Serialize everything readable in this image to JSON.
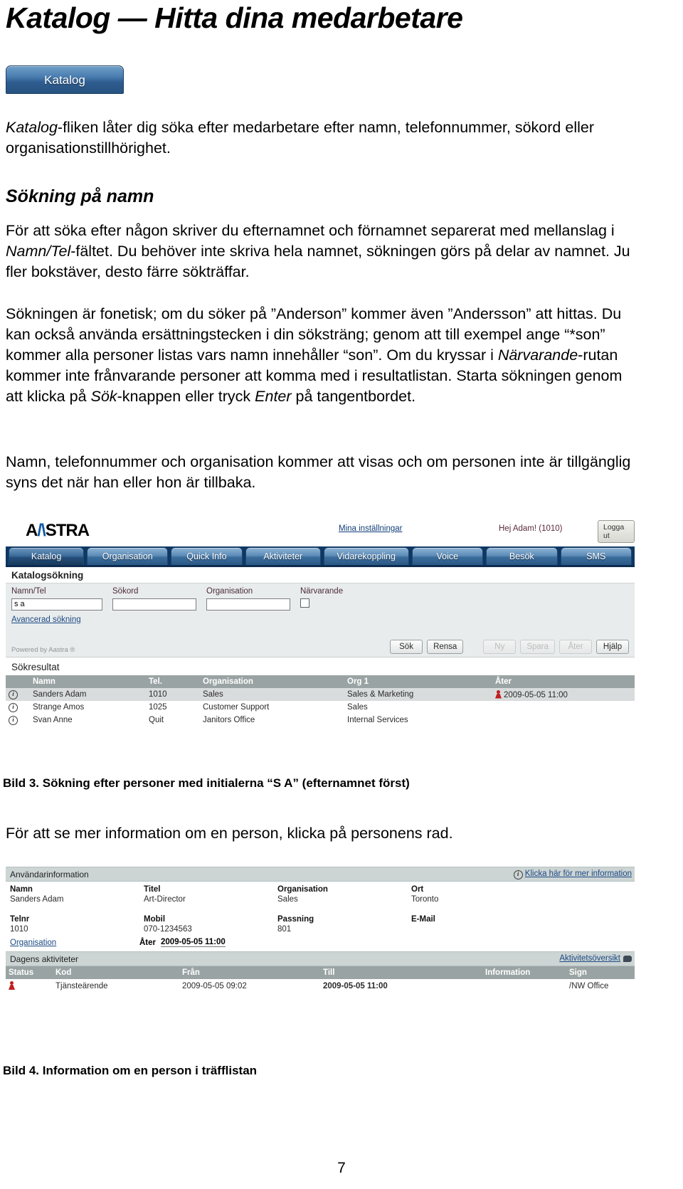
{
  "document": {
    "title": "Katalog — Hitta dina medarbetare",
    "tab_button_label": "Katalog",
    "page_number": "7",
    "paragraph_1": "Katalog-fliken låter dig söka efter medarbetare efter namn, telefonnummer, sökord eller organisationstillhörighet.",
    "section_heading": "Sökning på namn",
    "paragraph_2": "För att söka efter någon skriver du efternamnet och förnamnet separerat med mellanslag i Namn/Tel-fältet. Du behöver inte skriva hela namnet, sökningen görs på delar av namnet. Ju fler bokstäver, desto färre sökträffar.",
    "paragraph_3": "Sökningen är fonetisk; om du söker på ”Anderson” kommer även ”Andersson” att hittas. Du kan också använda ersättningstecken i din söksträng; genom att till exempel ange “*son” kommer alla personer listas vars namn innehåller “son”. Om du kryssar i Närvarande-rutan kommer inte frånvarande personer att komma med i resultatlistan. Starta sökningen genom att klicka på Sök-knappen eller tryck Enter på tangentbordet.",
    "paragraph_4": "Namn, telefonnummer och organisation kommer att visas och om personen inte är tillgänglig syns det när han eller hon är tillbaka.",
    "caption_3": "Bild 3. Sökning efter personer med initialerna “S A” (efternamnet först)",
    "paragraph_5": "För att se mer information om en person, klicka på personens rad.",
    "caption_4": "Bild 4. Information om en person i träfflistan"
  },
  "colors": {
    "tab_active": "#17395c",
    "tab_normal": "#3a6d9c",
    "header_bar": "#0e3763",
    "grid_header": "#9aa3a3",
    "panel_bar": "#ccd4d4",
    "link": "#1c4a84",
    "status_red": "#c01f1f"
  },
  "app": {
    "logo_text": "AASTRA",
    "header": {
      "settings_link": "Mina inställningar",
      "user_greeting": "Hej Adam! (1010)",
      "logout_button": "Logga ut"
    },
    "tabs": [
      {
        "label": "Katalog",
        "active": true
      },
      {
        "label": "Organisation",
        "active": false
      },
      {
        "label": "Quick Info",
        "active": false
      },
      {
        "label": "Aktiviteter",
        "active": false
      },
      {
        "label": "Vidarekoppling",
        "active": false
      },
      {
        "label": "Voice",
        "active": false
      },
      {
        "label": "Besök",
        "active": false
      },
      {
        "label": "SMS",
        "active": false
      }
    ],
    "search": {
      "panel_title": "Katalogsökning",
      "fields": {
        "namn_label": "Namn/Tel",
        "namn_value": "s a",
        "sokord_label": "Sökord",
        "sokord_value": "",
        "organisation_label": "Organisation",
        "organisation_value": "",
        "narvarande_label": "Närvarande",
        "narvarande_checked": false
      },
      "advanced_link": "Avancerad sökning",
      "powered_by": "Powered by Aastra ®",
      "buttons": [
        {
          "label": "Sök",
          "disabled": false
        },
        {
          "label": "Rensa",
          "disabled": false
        },
        {
          "label": "Ny",
          "disabled": true
        },
        {
          "label": "Spara",
          "disabled": true
        },
        {
          "label": "Åter",
          "disabled": true
        },
        {
          "label": "Hjälp",
          "disabled": false
        }
      ]
    },
    "results": {
      "title": "Sökresultat",
      "columns": [
        "",
        "Namn",
        "Tel.",
        "Organisation",
        "Org 1",
        "Åter"
      ],
      "rows": [
        {
          "icon": "info-icon",
          "namn": "Sanders Adam",
          "tel": "1010",
          "organisation": "Sales",
          "org1": "Sales & Marketing",
          "ater": "2009-05-05 11:00",
          "has_status_icon": true,
          "selected": true
        },
        {
          "icon": "info-icon",
          "namn": "Strange Amos",
          "tel": "1025",
          "organisation": "Customer Support",
          "org1": "Sales",
          "ater": "",
          "has_status_icon": false,
          "selected": false
        },
        {
          "icon": "info-icon",
          "namn": "Svan Anne",
          "tel": "Quit",
          "organisation": "Janitors Office",
          "org1": "Internal Services",
          "ater": "",
          "has_status_icon": false,
          "selected": false
        }
      ]
    },
    "user_info": {
      "bar_title": "Användarinformation",
      "more_info_link": "Klicka här för mer information",
      "row1_labels": [
        "Namn",
        "Titel",
        "Organisation",
        "Ort"
      ],
      "row1_values": [
        "Sanders Adam",
        "Art-Director",
        "Sales",
        "Toronto"
      ],
      "row2_labels": [
        "Telnr",
        "Mobil",
        "Passning",
        "E-Mail"
      ],
      "row2_values": [
        "1010",
        "070-1234563",
        "801",
        ""
      ],
      "organisation_link": "Organisation",
      "ater_label": "Åter",
      "ater_value": "2009-05-05 11:00"
    },
    "activities": {
      "bar_title": "Dagens aktiviteter",
      "overview_link": "Aktivitetsöversikt",
      "columns": [
        "Status",
        "Kod",
        "Från",
        "Till",
        "Information",
        "Sign"
      ],
      "rows": [
        {
          "status_icon": "pawn-icon",
          "kod": "Tjänsteärende",
          "fran": "2009-05-05 09:02",
          "till": "2009-05-05 11:00",
          "information": "",
          "sign": "/NW Office"
        }
      ]
    }
  }
}
